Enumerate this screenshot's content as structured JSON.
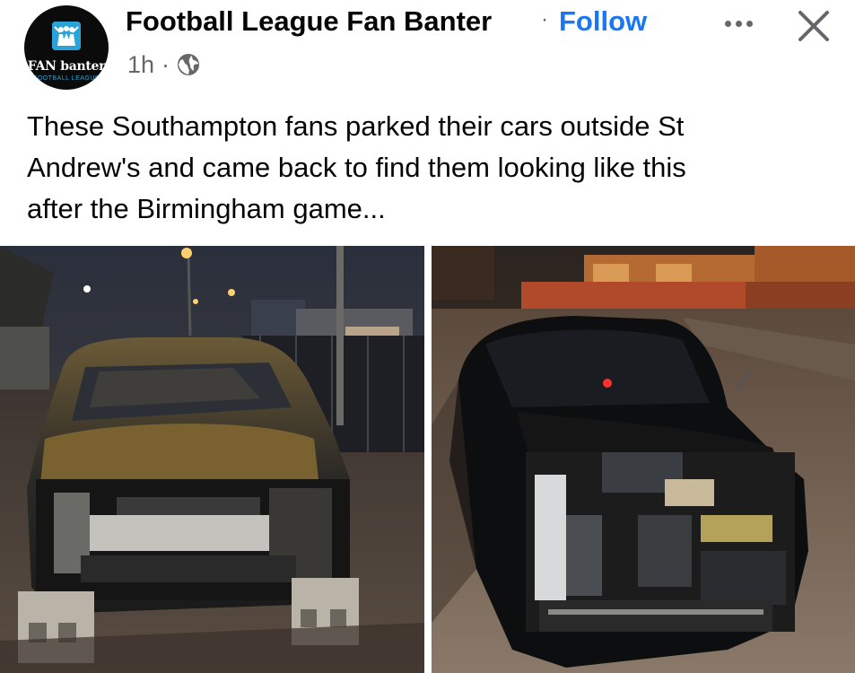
{
  "post": {
    "page_name": "Football League Fan Banter",
    "separator": "·",
    "follow_label": "Follow",
    "time": "1h",
    "meta_separator": "·",
    "privacy_icon": "globe-icon",
    "avatar": {
      "logo_text": "FAN banter",
      "logo_subtext": "FOOTBALL LEAGUE"
    },
    "text_lines": [
      "These Southampton fans parked their cars outside St",
      "Andrew's and came back to find them looking like this",
      "after the Birmingham game..."
    ],
    "photos": [
      {
        "name": "car-photo-left",
        "icon": "photo"
      },
      {
        "name": "car-photo-right",
        "icon": "photo"
      }
    ]
  },
  "colors": {
    "follow": "#1877f2",
    "secondary_text": "#65676b",
    "primary_text": "#050505",
    "logo_accent": "#2aa3d8"
  },
  "icons": {
    "more": "more-options-icon",
    "close": "close-icon"
  }
}
